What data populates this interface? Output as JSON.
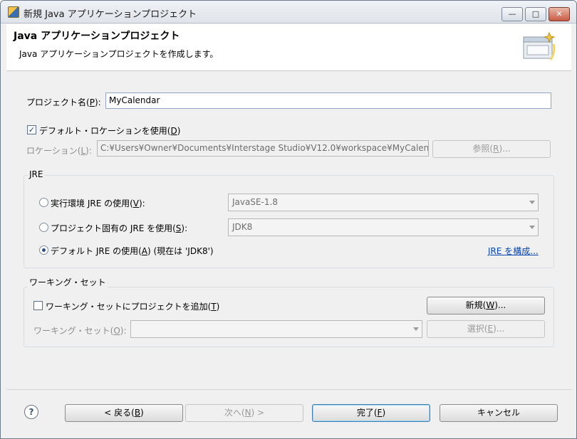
{
  "window": {
    "title": "新規 Java アプリケーションプロジェクト",
    "min_glyph": "—",
    "max_glyph": "□",
    "close_glyph": "✕"
  },
  "header": {
    "title": "Java アプリケーションプロジェクト",
    "description": "Java アプリケーションプロジェクトを作成します。"
  },
  "project": {
    "label_prefix": "プロジェクト名(",
    "label_key": "P",
    "label_suffix": "):",
    "value": "MyCalendar"
  },
  "default_location": {
    "checked_glyph": "✓",
    "label_prefix": "デフォルト・ロケーションを使用(",
    "label_key": "D",
    "label_suffix": ")"
  },
  "location": {
    "label_prefix": "ロケーション(",
    "label_key": "L",
    "label_suffix": "):",
    "value": "C:¥Users¥Owner¥Documents¥Interstage Studio¥V12.0¥workspace¥MyCalenda",
    "browse_prefix": "参照(",
    "browse_key": "R",
    "browse_suffix": ")..."
  },
  "jre": {
    "group_title": "JRE",
    "env": {
      "label_prefix": "実行環境 JRE の使用(",
      "label_key": "V",
      "label_suffix": "):",
      "value": "JavaSE-1.8"
    },
    "project_specific": {
      "label_prefix": "プロジェクト固有の JRE を使用(",
      "label_key": "S",
      "label_suffix": "):",
      "value": "JDK8"
    },
    "default": {
      "label_prefix": "デフォルト JRE の使用(",
      "label_key": "A",
      "label_suffix": ") (現在は 'JDK8')"
    },
    "configure_link": "JRE を構成..."
  },
  "working_set": {
    "group_title": "ワーキング・セット",
    "add": {
      "label_prefix": "ワーキング・セットにプロジェクトを追加(",
      "label_key": "T",
      "label_suffix": ")"
    },
    "new_prefix": "新規(",
    "new_key": "W",
    "new_suffix": ")...",
    "sets": {
      "label_prefix": "ワーキング・セット(",
      "label_key": "O",
      "label_suffix": "):",
      "value": ""
    },
    "select_prefix": "選択(",
    "select_key": "E",
    "select_suffix": ")..."
  },
  "footer": {
    "help_glyph": "?",
    "back_prefix": "< 戻る(",
    "back_key": "B",
    "back_suffix": ")",
    "next_prefix": "次へ(",
    "next_key": "N",
    "next_suffix": ") >",
    "finish_prefix": "完了(",
    "finish_key": "F",
    "finish_suffix": ")",
    "cancel": "キャンセル"
  }
}
